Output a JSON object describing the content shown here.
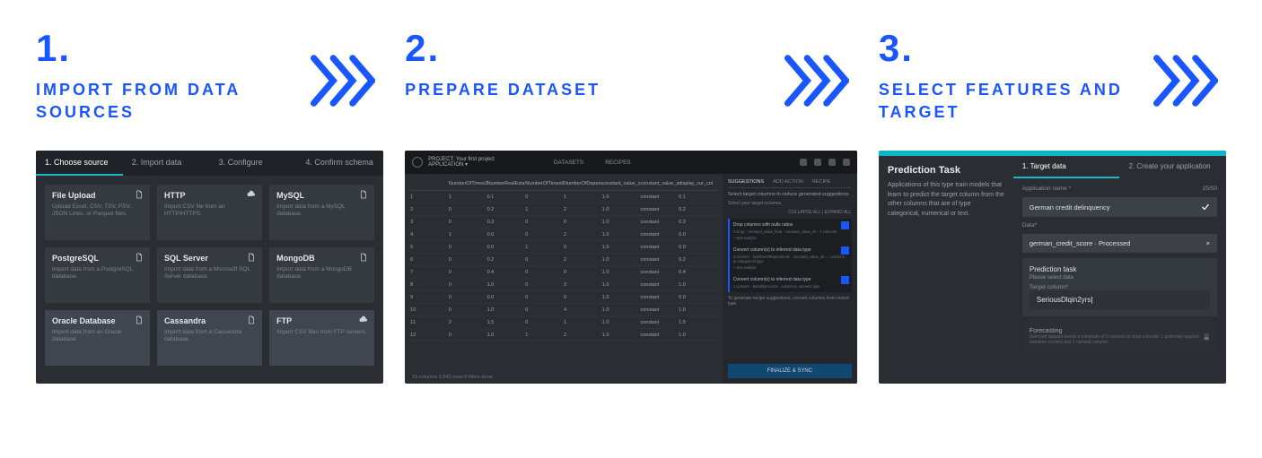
{
  "steps": [
    {
      "num": "1.",
      "title": "IMPORT FROM DATA SOURCES"
    },
    {
      "num": "2.",
      "title": "PREPARE DATASET"
    },
    {
      "num": "3.",
      "title": "SELECT FEATURES AND TARGET"
    }
  ],
  "step1": {
    "tabs": [
      "1. Choose source",
      "2. Import data",
      "3. Configure",
      "4. Confirm schema"
    ],
    "cards": [
      {
        "title": "File Upload",
        "sub": "Upload Excel, CSV, TSV, PSV, JSON Lines, or Parquet files.",
        "icon": "file"
      },
      {
        "title": "HTTP",
        "sub": "Import CSV file from an HTTP/HTTPS.",
        "icon": "cloud"
      },
      {
        "title": "MySQL",
        "sub": "Import data from a MySQL database.",
        "icon": "file"
      },
      {
        "title": "PostgreSQL",
        "sub": "Import data from a PostgreSQL database.",
        "icon": "file"
      },
      {
        "title": "SQL Server",
        "sub": "Import data from a Microsoft SQL Server database.",
        "icon": "file"
      },
      {
        "title": "MongoDB",
        "sub": "Import data from a MongoDB database.",
        "icon": "file"
      },
      {
        "title": "Oracle Database",
        "sub": "Import data from an Oracle database.",
        "icon": "file"
      },
      {
        "title": "Cassandra",
        "sub": "Import data from a Cassandra database.",
        "icon": "file"
      },
      {
        "title": "FTP",
        "sub": "Import CSV files from FTP servers.",
        "icon": "cloud"
      }
    ]
  },
  "step2": {
    "project_label": "PROJECT: Your first project",
    "project_sub": "APPLICATION ▾",
    "navs": [
      "DATASETS",
      "RECIPES"
    ],
    "columns": [
      "",
      "NumberOfTimes30…",
      "NumberRealEstate…",
      "NumberOfTimes60_8…",
      "NumberOfDepend…",
      "constant_value_str",
      "constant_value_int",
      "display_cur_col"
    ],
    "rows": [
      [
        "1",
        "1",
        "0.1",
        "0",
        "1",
        "1.0",
        "constant",
        "0.1"
      ],
      [
        "2",
        "0",
        "0.2",
        "1",
        "2",
        "1.0",
        "constant",
        "0.2"
      ],
      [
        "3",
        "0",
        "0.3",
        "0",
        "0",
        "1.0",
        "constant",
        "0.3"
      ],
      [
        "4",
        "1",
        "0.0",
        "0",
        "2",
        "1.0",
        "constant",
        "0.0"
      ],
      [
        "5",
        "0",
        "0.0",
        "1",
        "0",
        "1.0",
        "constant",
        "0.0"
      ],
      [
        "6",
        "0",
        "0.2",
        "0",
        "2",
        "1.0",
        "constant",
        "0.2"
      ],
      [
        "7",
        "0",
        "0.4",
        "0",
        "0",
        "1.0",
        "constant",
        "0.4"
      ],
      [
        "8",
        "0",
        "1.0",
        "0",
        "3",
        "1.0",
        "constant",
        "1.0"
      ],
      [
        "9",
        "0",
        "0.0",
        "0",
        "0",
        "1.0",
        "constant",
        "0.0"
      ],
      [
        "10",
        "0",
        "1.0",
        "0",
        "4",
        "1.0",
        "constant",
        "1.0"
      ],
      [
        "11",
        "2",
        "1.5",
        "0",
        "1",
        "1.0",
        "constant",
        "1.5"
      ],
      [
        "12",
        "0",
        "1.0",
        "1",
        "2",
        "1.0",
        "constant",
        "1.0"
      ]
    ],
    "footer": "15 columns   6,943 rows   6 filters done",
    "side_header": "Select target columns to reduce generated suggestions.",
    "side_prompt": "Select your target columns.",
    "side_collapse": "COLLAPSE ALL | EXPAND ALL",
    "side_tabs": [
      "SUGGESTIONS",
      "ADD ACTION",
      "RECIPE"
    ],
    "recipes": [
      {
        "title": "Drop columns with nulls ratios",
        "sub": "1 Drop · constant_value_float · constant_value_int · 4 columns",
        "analyze": "+ see analyze"
      },
      {
        "title": "Convert column(s) to inferred data type",
        "sub": "3 Convert · NumberOfDependents · constant_value_str …  columns to categorical type",
        "analyze": "+ see analyze"
      },
      {
        "title": "Convert column(s) to inferred data type",
        "sub": "1 Convert · MonthlyIncome · column to numeric type",
        "analyze": ""
      }
    ],
    "side_note": "To generate recipe suggestions, convert columns from mixed type.",
    "finalize": "FINALIZE & SYNC"
  },
  "step3": {
    "panel_title": "Prediction Task",
    "panel_desc": "Applications of this type train models that learn to predict the target column from the other columns that are of type categorical, numerical or text.",
    "tabs": [
      "1. Target data",
      "2. Create your application"
    ],
    "app_name_label": "Application name *",
    "app_name_counter": "25/50",
    "app_name_value": "German credit delinquency",
    "data_label": "Data*",
    "data_value": "german_credit_score · Processed",
    "pred_title": "Prediction task",
    "pred_sub": "Please select data",
    "target_label": "Target column*",
    "target_value": "SeriousDlqin2yrs",
    "forecast_title": "Forecasting",
    "forecast_sub": "Selected dataset needs a minimum of 3 columns to train a model: 1 uniformly-spaced datetime column and 1 numeric column."
  }
}
